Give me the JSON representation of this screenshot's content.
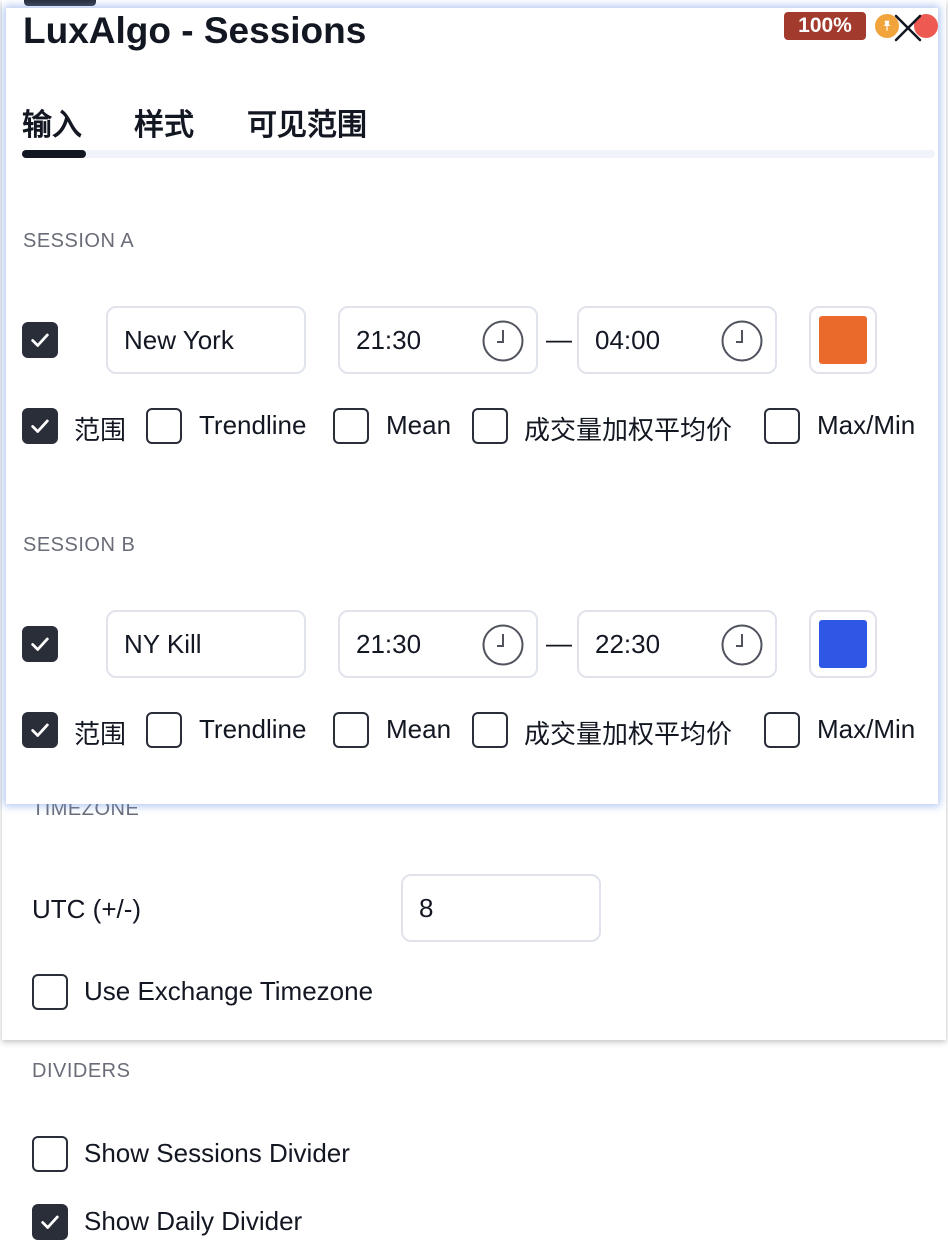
{
  "dialog": {
    "title": "LuxAlgo - Sessions",
    "zoom_badge": "100%",
    "tabs": [
      "输入",
      "样式",
      "可见范围"
    ]
  },
  "sessions": [
    {
      "heading": "SESSION A",
      "enabled": true,
      "name": "New York",
      "start": "21:30",
      "separator": "—",
      "end": "04:00",
      "color": "#ea6a2c",
      "options": [
        {
          "label": "范围",
          "checked": true
        },
        {
          "label": "Trendline",
          "checked": false
        },
        {
          "label": "Mean",
          "checked": false
        },
        {
          "label": "成交量加权平均价",
          "checked": false
        },
        {
          "label": "Max/Min",
          "checked": false
        }
      ]
    },
    {
      "heading": "SESSION B",
      "enabled": true,
      "name": "NY Kill",
      "start": "21:30",
      "separator": "—",
      "end": "22:30",
      "color": "#2f57e6",
      "options": [
        {
          "label": "范围",
          "checked": true
        },
        {
          "label": "Trendline",
          "checked": false
        },
        {
          "label": "Mean",
          "checked": false
        },
        {
          "label": "成交量加权平均价",
          "checked": false
        },
        {
          "label": "Max/Min",
          "checked": false
        }
      ]
    }
  ],
  "timezone": {
    "heading": "TIMEZONE",
    "utc_label": "UTC (+/-)",
    "utc_value": "8",
    "use_exchange_label": "Use Exchange Timezone",
    "use_exchange_checked": false
  },
  "dividers": {
    "heading": "DIVIDERS",
    "sessions_label": "Show Sessions Divider",
    "sessions_checked": false,
    "daily_label": "Show Daily Divider",
    "daily_checked": true
  },
  "icons": {
    "checkbox": "checkmark-icon",
    "time": "clock-icon",
    "pin": "pin-icon",
    "close": "close-icon"
  }
}
